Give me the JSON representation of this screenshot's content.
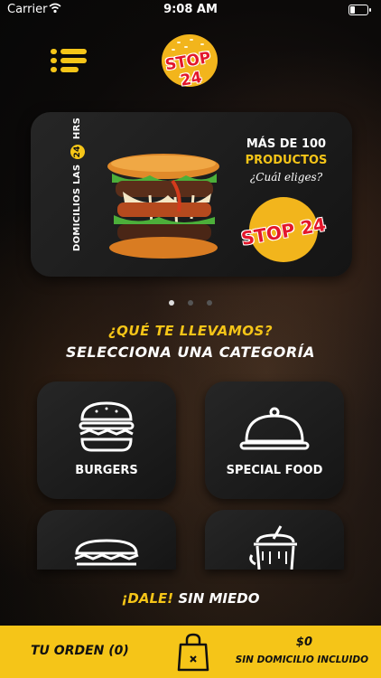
{
  "status_bar": {
    "carrier": "Carrier",
    "time": "9:08 AM"
  },
  "header": {
    "menu_icon": "menu-icon",
    "logo_text": "STOP 24"
  },
  "banner": {
    "side_text_before": "DOMICILIOS LAS",
    "side_text_badge": "24",
    "side_text_after": "HRS",
    "line1": "MÁS DE 100",
    "line2": "PRODUCTOS",
    "line3": "¿Cuál eliges?",
    "logo_text": "STOP 24"
  },
  "pager": {
    "count": 3,
    "active_index": 0
  },
  "heading": {
    "question": "¿QUÉ TE LLEVAMOS?",
    "subtitle": "SELECCIONA UNA CATEGORÍA"
  },
  "categories": [
    {
      "label": "BURGERS",
      "icon": "burger-icon"
    },
    {
      "label": "SPECIAL FOOD",
      "icon": "cloche-icon"
    },
    {
      "label": "",
      "icon": "sub-sandwich-icon"
    },
    {
      "label": "",
      "icon": "milkshake-icon"
    }
  ],
  "slogan": {
    "highlight": "¡DALE!",
    "rest": "SIN MIEDO"
  },
  "bottom_bar": {
    "order_label": "TU ORDEN (0)",
    "bag_icon": "shopping-bag-icon",
    "price": "$0",
    "shipping_note": "SIN DOMICILIO INCLUIDO"
  },
  "colors": {
    "accent": "#f5c518",
    "brand_red": "#e3172b",
    "card": "#1e1e1e"
  }
}
